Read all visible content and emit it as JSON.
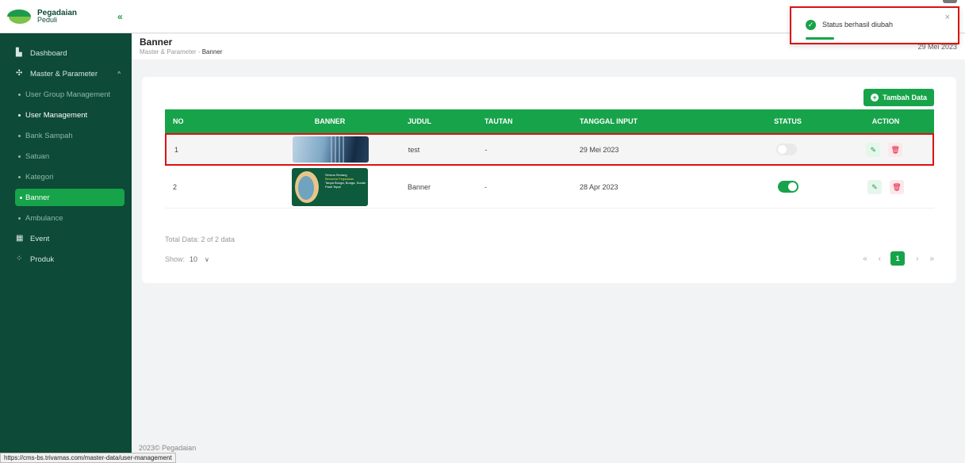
{
  "brand": {
    "name": "Pegadaian",
    "sub": "Peduli"
  },
  "sidebar": {
    "collapse_icon": "double-chevron-left-icon",
    "items": [
      {
        "label": "Dashboard",
        "icon": "chart-bar-icon"
      },
      {
        "label": "Master & Parameter",
        "icon": "settings-icon"
      }
    ],
    "sub_items": [
      {
        "label": "User Group Management"
      },
      {
        "label": "User Management"
      },
      {
        "label": "Bank Sampah"
      },
      {
        "label": "Satuan"
      },
      {
        "label": "Kategori"
      },
      {
        "label": "Banner"
      },
      {
        "label": "Ambulance"
      }
    ],
    "bottom_items": [
      {
        "label": "Event",
        "icon": "calendar-icon"
      },
      {
        "label": "Produk",
        "icon": "grid-icon"
      }
    ]
  },
  "header": {
    "title": "Banner",
    "breadcrumb_parent": "Master & Parameter",
    "breadcrumb_sep": "-",
    "breadcrumb_current": "Banner",
    "date": "29 Mei 2023"
  },
  "toast": {
    "message": "Status berhasil diubah",
    "close": "×"
  },
  "main": {
    "add_button": "Tambah Data",
    "columns": [
      "NO",
      "BANNER",
      "JUDUL",
      "TAUTAN",
      "TANGGAL INPUT",
      "STATUS",
      "ACTION"
    ],
    "rows": [
      {
        "no": "1",
        "judul": "test",
        "tautan": "-",
        "tanggal": "29 Mei 2023",
        "status": false
      },
      {
        "no": "2",
        "judul": "Banner",
        "tautan": "-",
        "tanggal": "28 Apr 2023",
        "status": true
      }
    ],
    "banner2_text": {
      "l1": "Semua Senang",
      "l2": "Bersama Pegadaian",
      "l3": "Tanpa Bunga, Bunga, Sudah Pasti Tepat"
    },
    "total": "Total Data: 2 of 2 data",
    "show_label": "Show:",
    "show_value": "10",
    "pager": {
      "first": "«",
      "prev": "‹",
      "current": "1",
      "next": "›",
      "last": "»"
    }
  },
  "footer": "2023© Pegadaian",
  "status_url": "https://cms-bs.trivamas.com/master-data/user-management",
  "colors": {
    "sidebar": "#0d4a38",
    "accent": "#17a34a",
    "danger": "#e0113a"
  }
}
